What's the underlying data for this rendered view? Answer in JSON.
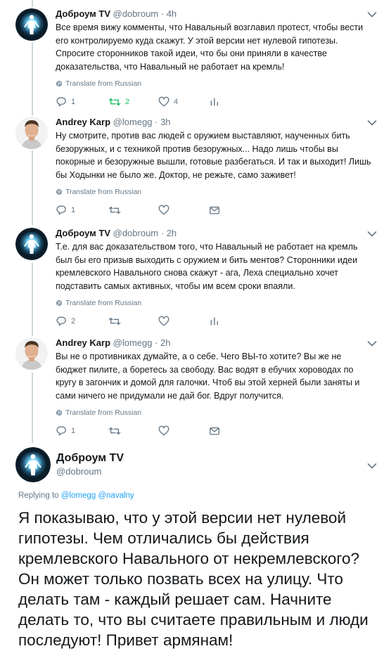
{
  "tweets": [
    {
      "name": "Доброум TV",
      "handle": "@dobroum",
      "time": "· 4h",
      "text": "Все время вижу комменты, что Навальный возглавил протест, чтобы вести его контролируемо куда скажут. У этой версии нет нулевой гипотезы. Спросите сторонников такой идеи, что бы они приняли в качестве доказательства, что Навальный не работает на кремль!",
      "translate": "Translate from Russian",
      "replies": "1",
      "retweets": "2",
      "likes": "4"
    },
    {
      "name": "Andrey Karp",
      "handle": "@lomegg",
      "time": "· 3h",
      "text": "Ну смотрите, против вас людей с оружием выставляют, наученных бить безоружных, и с техникой против безоружных... Надо лишь чтобы вы покорные и безоружные вышли, готовые разбегаться. И так и выходит! Лишь бы Ходынки не было же. Доктор, не режьте, само заживет!",
      "translate": "Translate from Russian",
      "replies": "1"
    },
    {
      "name": "Доброум TV",
      "handle": "@dobroum",
      "time": "· 2h",
      "text": "Т.е. для вас доказательством того, что Навальный не работает на кремль был бы его призыв выходить с оружием и бить ментов? Сторонники идеи кремлевского Навального снова скажут - ага, Леха специально хочет подставить самых активных, чтобы им всем сроки впаяли.",
      "translate": "Translate from Russian",
      "replies": "2"
    },
    {
      "name": "Andrey Karp",
      "handle": "@lomegg",
      "time": "· 2h",
      "text": "Вы не о противниках думайте, а о себе. Чего ВЫ-то хотите? Вы же не бюджет пилите, а боретесь за свободу. Вас водят в ебучих хороводах по кругу в загончик и домой для галочки. Чтоб вы этой херней были заняты и сами ничего не придумали не дай бог. Вдруг получится.",
      "translate": "Translate from Russian",
      "replies": "1"
    }
  ],
  "main": {
    "name": "Доброум TV",
    "handle": "@dobroum",
    "replying_prefix": "Replying to",
    "replying_user1": "@lomegg",
    "replying_user2": "@navalny",
    "text": "Я показываю, что у этой версии нет нулевой гипотезы. Чем отличались бы действия кремлевского Навального от некремлевского? Он может только позвать всех на улицу. Что делать там - каждый решает сам. Начните делать то, что вы считаете правильным и люди последуют! Привет армянам!"
  },
  "colors": {
    "text": "#14171a",
    "muted": "#657786",
    "link": "#1da1f2",
    "retweet": "#17bf63",
    "thread_line": "#ccd6dd"
  },
  "icons": [
    "reply-icon",
    "retweet-icon",
    "like-icon",
    "analytics-icon",
    "message-icon",
    "globe-icon",
    "chevron-down-icon"
  ]
}
